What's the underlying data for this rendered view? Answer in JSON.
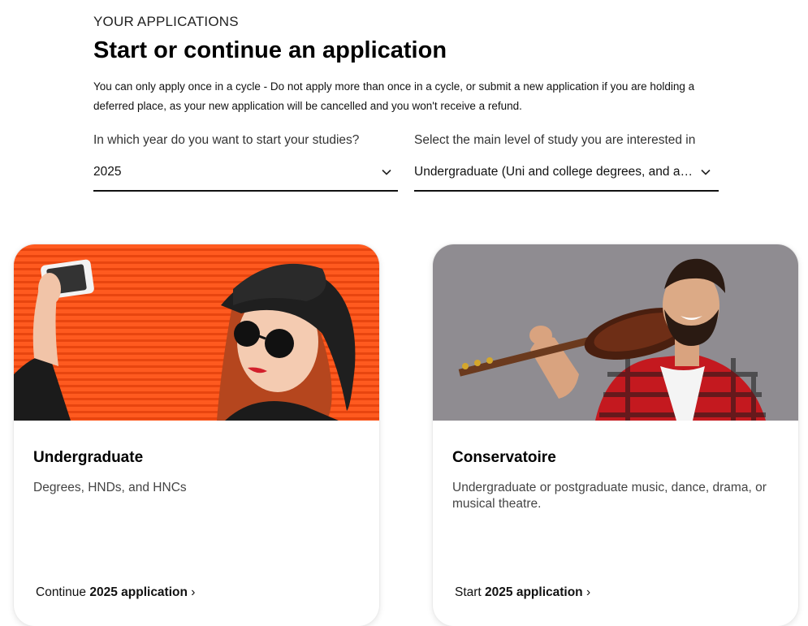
{
  "header": {
    "eyebrow": "YOUR APPLICATIONS",
    "title": "Start or continue an application",
    "intro": "You can only apply once in a cycle - Do not apply more than once in a cycle, or submit a new application if you are holding a deferred place, as your new application will be cancelled and you won't receive a refund."
  },
  "filters": {
    "year": {
      "label": "In which year do you want to start your studies?",
      "value": "2025"
    },
    "level": {
      "label": "Select the main level of study you are interested in",
      "value": "Undergraduate (Uni and college degrees, and apprenticeships)"
    }
  },
  "cards": [
    {
      "title": "Undergraduate",
      "description": "Degrees, HNDs, and HNCs",
      "link_prefix": "Continue",
      "link_bold": "2025 application",
      "link_suffix": "›"
    },
    {
      "title": "Conservatoire",
      "description": "Undergraduate or postgraduate music, dance, drama, or musical theatre.",
      "link_prefix": "Start",
      "link_bold": "2025 application",
      "link_suffix": "›"
    }
  ],
  "colors": {
    "ug_background": "#ff5a1f",
    "cons_background": "#8f8c91",
    "text": "#111111"
  },
  "icons": {
    "dropdown": "chevron-down-icon"
  }
}
